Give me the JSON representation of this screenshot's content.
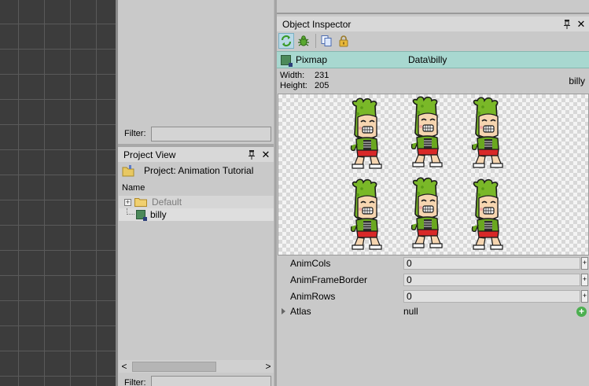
{
  "middle_panel": {
    "filter_label_top": "Filter:",
    "filter_label_bottom": "Filter:"
  },
  "project_view": {
    "title": "Project View",
    "project_label": "Project: Animation Tutorial",
    "column_header": "Name",
    "tree": [
      {
        "label": "Default",
        "expander": "+"
      },
      {
        "label": "billy"
      }
    ]
  },
  "inspector": {
    "title": "Object Inspector",
    "resource": {
      "type": "Pixmap",
      "path": "Data\\billy",
      "name": "billy"
    },
    "width_label": "Width:",
    "width_value": "231",
    "height_label": "Height:",
    "height_value": "205",
    "properties": [
      {
        "label": "AnimCols",
        "value": "0"
      },
      {
        "label": "AnimFrameBorder",
        "value": "0"
      },
      {
        "label": "AnimRows",
        "value": "0"
      }
    ],
    "atlas": {
      "label": "Atlas",
      "value": "null"
    }
  },
  "icons": {
    "pin": "pin-icon",
    "close": "close-icon",
    "refresh": "refresh-icon",
    "debug": "bug-icon",
    "copy": "copy-icon",
    "lock": "lock-icon"
  },
  "colors": {
    "pixmap_row": "#a8d8d0",
    "dino_green": "#7ab828",
    "add_button": "#4caf50"
  },
  "scroll_glyphs": {
    "left": "<",
    "right": ">"
  },
  "glyphs": {
    "close": "✕",
    "spin": "+",
    "add": "+"
  }
}
